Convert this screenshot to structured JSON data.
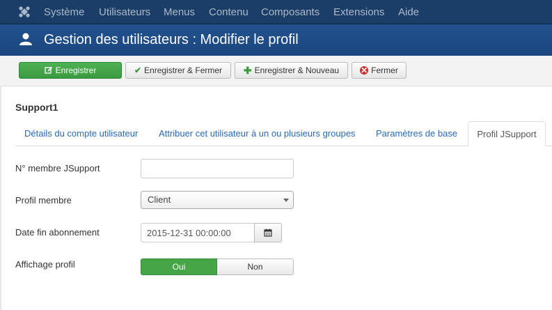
{
  "top_menu": {
    "items": [
      "Système",
      "Utilisateurs",
      "Menus",
      "Contenu",
      "Composants",
      "Extensions",
      "Aide"
    ]
  },
  "header": {
    "title": "Gestion des utilisateurs : Modifier le profil"
  },
  "toolbar": {
    "save_label": "Enregistrer",
    "save_close_label": "Enregistrer & Fermer",
    "save_new_label": "Enregistrer & Nouveau",
    "close_label": "Fermer"
  },
  "user": {
    "name": "Support1"
  },
  "tabs": [
    {
      "label": "Détails du compte utilisateur"
    },
    {
      "label": "Attribuer cet utilisateur à un ou plusieurs groupes"
    },
    {
      "label": "Paramètres de base"
    },
    {
      "label": "Profil JSupport",
      "active": true
    }
  ],
  "form": {
    "member_number": {
      "label": "N° membre JSupport",
      "value": ""
    },
    "member_profile": {
      "label": "Profil membre",
      "value": "Client"
    },
    "subscription_end": {
      "label": "Date fin abonnement",
      "value": "2015-12-31 00:00:00"
    },
    "profile_display": {
      "label": "Affichage profil",
      "yes": "Oui",
      "no": "Non",
      "selected": "Oui"
    }
  },
  "colors": {
    "topbar": "#1b3e68",
    "titlebar": "#1e4a86",
    "save_button": "#46a546",
    "link": "#2a69b8"
  }
}
